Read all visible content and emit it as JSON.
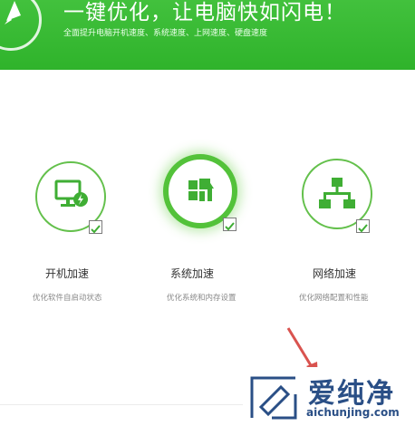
{
  "header": {
    "title": "一键优化，让电脑快如闪电！",
    "subtitle": "全面提升电脑开机速度、系统速度、上网速度、硬盘速度"
  },
  "features": [
    {
      "title": "开机加速",
      "desc": "优化软件自启动状态",
      "icon": "monitor-lightning-icon",
      "checked": true
    },
    {
      "title": "系统加速",
      "desc": "优化系统和内存设置",
      "icon": "windows-upload-icon",
      "checked": true,
      "active": true
    },
    {
      "title": "网络加速",
      "desc": "优化网络配置和性能",
      "icon": "network-icon",
      "checked": true
    }
  ],
  "watermark": {
    "text": "爱纯净",
    "url": "aichunjing.com"
  },
  "colors": {
    "accent": "#3cb935",
    "ring": "#63c04b",
    "arrow": "#d9534f",
    "watermark": "#2a4f86"
  }
}
